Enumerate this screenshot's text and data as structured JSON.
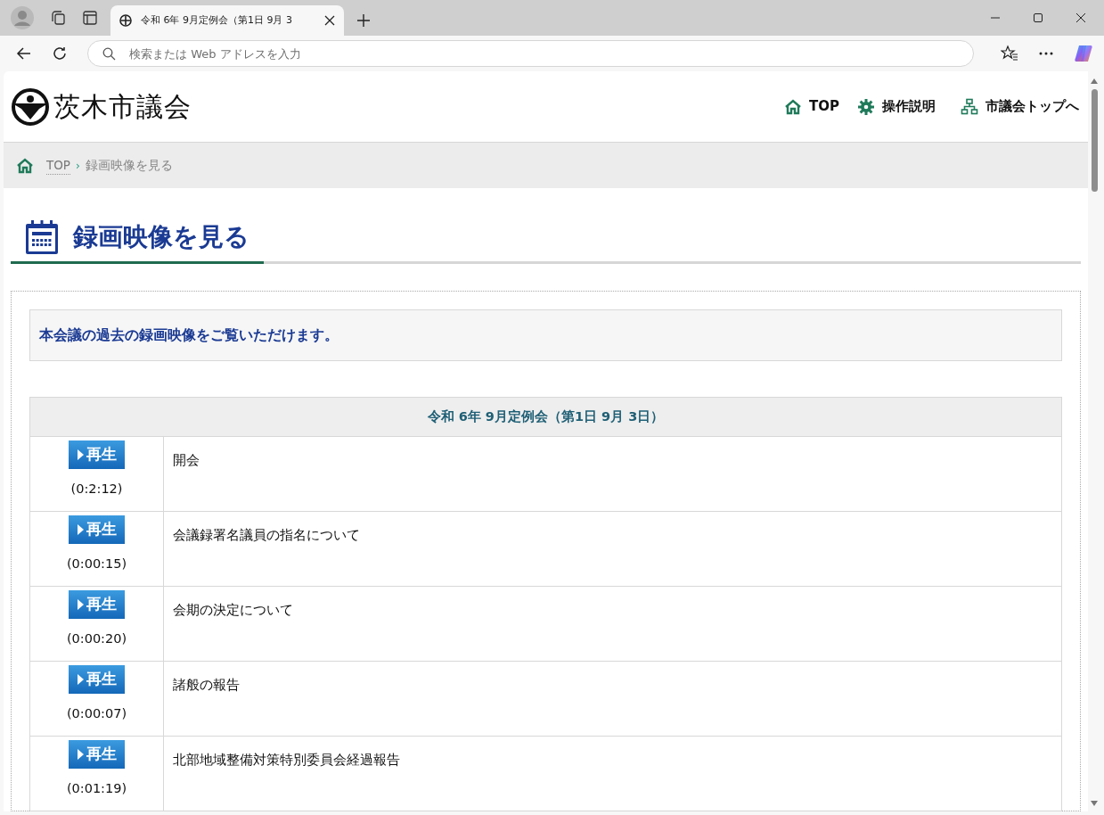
{
  "browser": {
    "tab": {
      "title": "令和 6年 9月定例会（第1日 9月 3",
      "selected": true
    },
    "address": {
      "placeholder": "検索または Web アドレスを入力"
    }
  },
  "site": {
    "logo": "茨木市議会",
    "nav": [
      {
        "kind": "home",
        "label": "TOP"
      },
      {
        "kind": "gear",
        "label": "操作説明"
      },
      {
        "kind": "sitemap",
        "label": "市議会トップへ"
      }
    ]
  },
  "breadcrumb": {
    "items": [
      "TOP"
    ],
    "separator": "›",
    "current": "録画映像を見る"
  },
  "page_title": "録画映像を見る",
  "intro": "本会議の過去の録画映像をご覧いただけます。",
  "table": {
    "caption": "令和 6年 9月定例会（第1日 9月 3日）",
    "rows": [
      {
        "button": "再生",
        "duration": "(0:2:12)",
        "title": "開会"
      },
      {
        "button": "再生",
        "duration": "(0:00:15)",
        "title": "会議録署名議員の指名について"
      },
      {
        "button": "再生",
        "duration": "(0:00:20)",
        "title": "会期の決定について"
      },
      {
        "button": "再生",
        "duration": "(0:00:07)",
        "title": "諸般の報告"
      },
      {
        "button": "再生",
        "duration": "(0:01:19)",
        "title": "北部地域整備対策特別委員会経過報告"
      }
    ]
  }
}
